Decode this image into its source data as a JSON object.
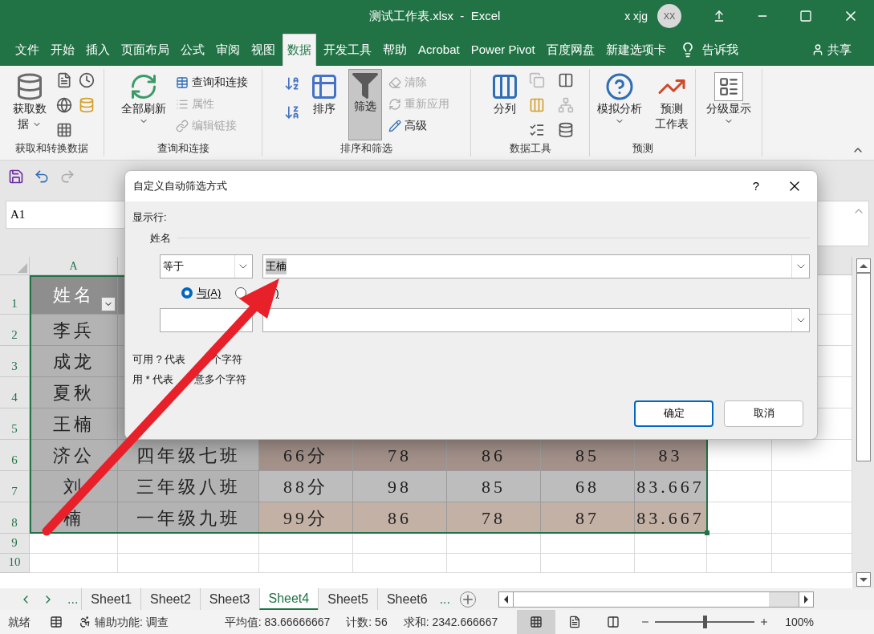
{
  "window": {
    "title": "测试工作表.xlsx  -  Excel",
    "user": "x xjg",
    "avatar": "XX"
  },
  "ribbon_tabs": [
    {
      "label": "文件",
      "selected": false
    },
    {
      "label": "开始",
      "selected": false
    },
    {
      "label": "插入",
      "selected": false
    },
    {
      "label": "页面布局",
      "selected": false
    },
    {
      "label": "公式",
      "selected": false
    },
    {
      "label": "审阅",
      "selected": false
    },
    {
      "label": "视图",
      "selected": false
    },
    {
      "label": "数据",
      "selected": true
    },
    {
      "label": "开发工具",
      "selected": false
    },
    {
      "label": "帮助",
      "selected": false
    },
    {
      "label": "Acrobat",
      "selected": false
    },
    {
      "label": "Power Pivot",
      "selected": false
    },
    {
      "label": "百度网盘",
      "selected": false
    },
    {
      "label": "新建选项卡",
      "selected": false
    }
  ],
  "tell_me": "告诉我",
  "share": "共享",
  "ribbon_groups": [
    {
      "label": "获取和转换数据",
      "columns": [
        {
          "kind": "big",
          "lines": [
            "获取数",
            "据"
          ],
          "caret": true,
          "pressed": false
        },
        {
          "kind": "icons"
        }
      ]
    },
    {
      "label": "查询和连接",
      "columns": [
        {
          "kind": "big",
          "lines": [
            "全部刷新"
          ],
          "caret": true,
          "pressed": false
        },
        {
          "kind": "stack",
          "items": [
            {
              "label": "查询和连接",
              "disabled": false
            },
            {
              "label": "属性",
              "disabled": true
            },
            {
              "label": "编辑链接",
              "disabled": true
            }
          ]
        }
      ]
    },
    {
      "label": "排序和筛选",
      "columns": [
        {
          "kind": "icons"
        },
        {
          "kind": "big",
          "lines": [
            "排序"
          ],
          "caret": false,
          "pressed": false
        },
        {
          "kind": "big",
          "lines": [
            "筛选"
          ],
          "caret": false,
          "pressed": true
        },
        {
          "kind": "stack",
          "items": [
            {
              "label": "清除",
              "disabled": true
            },
            {
              "label": "重新应用",
              "disabled": true
            },
            {
              "label": "高级",
              "disabled": false
            }
          ]
        }
      ]
    },
    {
      "label": "数据工具",
      "columns": [
        {
          "kind": "big",
          "lines": [
            "分列"
          ],
          "caret": false,
          "pressed": false
        },
        {
          "kind": "icons"
        }
      ]
    },
    {
      "label": "预测",
      "columns": [
        {
          "kind": "big",
          "lines": [
            "模拟分析"
          ],
          "caret": true,
          "pressed": false
        },
        {
          "kind": "big",
          "lines": [
            "预测",
            "工作表"
          ],
          "caret": false,
          "pressed": false
        }
      ]
    },
    {
      "columns": [
        {
          "kind": "big",
          "lines": [
            "分级显示"
          ],
          "caret": true,
          "pressed": false
        }
      ]
    }
  ],
  "name_box": "A1",
  "columns": [
    "A"
  ],
  "rows": [
    {
      "header": "1",
      "kind": "header",
      "cells": [
        "姓名"
      ]
    },
    {
      "header": "2",
      "kind": "data",
      "cells": [
        "李兵"
      ]
    },
    {
      "header": "3",
      "kind": "data",
      "cells": [
        "成龙"
      ]
    },
    {
      "header": "4",
      "kind": "data",
      "cells": [
        "夏秋"
      ]
    },
    {
      "header": "5",
      "kind": "data",
      "cells": [
        "王楠"
      ]
    },
    {
      "header": "6",
      "kind": "data",
      "cells": [
        "济公",
        "四年级七班",
        "66分",
        "78",
        "86",
        "85",
        "83"
      ]
    },
    {
      "header": "7",
      "kind": "data",
      "cells": [
        "刘",
        "三年级八班",
        "88分",
        "98",
        "85",
        "68",
        "83.667"
      ]
    },
    {
      "header": "8",
      "kind": "data",
      "cells": [
        "楠",
        "一年级九班",
        "99分",
        "86",
        "78",
        "87",
        "83.667"
      ]
    },
    {
      "header": "9",
      "kind": "empty"
    },
    {
      "header": "10",
      "kind": "empty"
    }
  ],
  "sheet_tabs": [
    {
      "label": "Sheet1",
      "selected": false
    },
    {
      "label": "Sheet2",
      "selected": false
    },
    {
      "label": "Sheet3",
      "selected": false
    },
    {
      "label": "Sheet4",
      "selected": true
    },
    {
      "label": "Sheet5",
      "selected": false
    },
    {
      "label": "Sheet6",
      "selected": false
    }
  ],
  "sheet_more": "...",
  "sheet_overflow": "...",
  "status_bar": {
    "ready": "就绪",
    "accessibility": "辅助功能: 调查",
    "average": "平均值: 83.66666667",
    "count": "计数: 56",
    "sum": "求和: 2342.666667",
    "views": [
      {
        "selected": true
      },
      {
        "selected": false
      },
      {
        "selected": false
      }
    ],
    "zoom": {
      "level": 0.5,
      "reading": "100%"
    }
  },
  "dialog": {
    "title": "自定义自动筛选方式",
    "help": "?",
    "section": "显示行:",
    "field": "姓名",
    "operator": "等于",
    "value": "王楠",
    "logic": [
      {
        "label": "与(A)",
        "selected": true
      },
      {
        "label": ")",
        "selected": false
      }
    ],
    "hints": [
      [
        "可用 ? 代表",
        "个字符"
      ],
      [
        "用 * 代表",
        "意多个字符"
      ]
    ],
    "ok": "确定",
    "cancel": "取消"
  }
}
